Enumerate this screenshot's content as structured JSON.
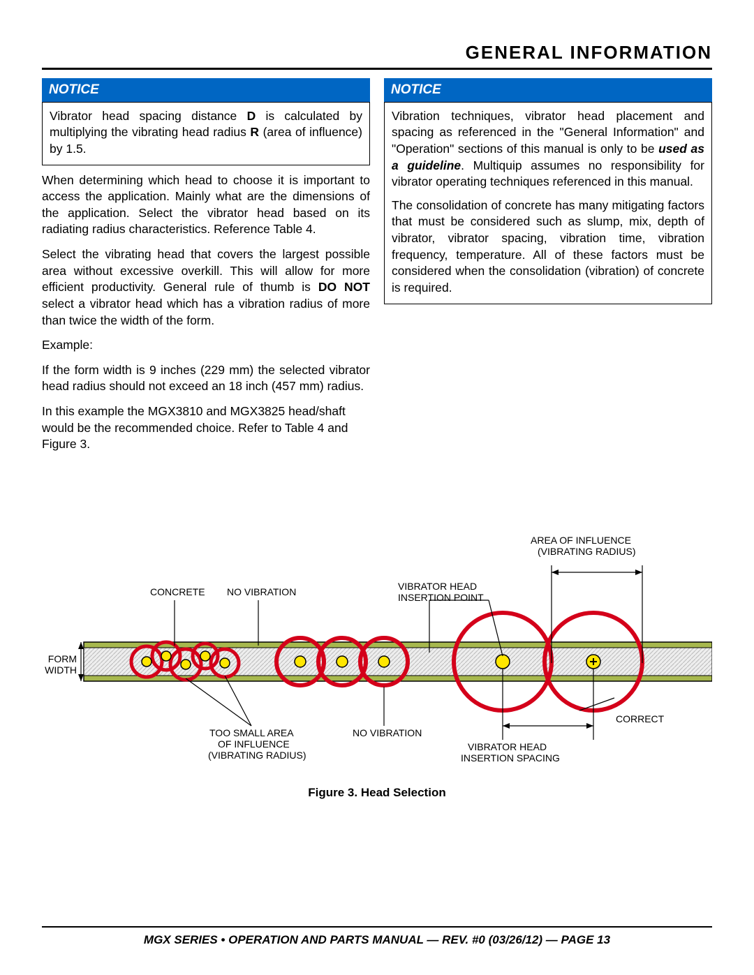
{
  "header": {
    "title": "General Information"
  },
  "left": {
    "notice_label": "NOTICE",
    "notice_body_prefix": "Vibrator head spacing distance ",
    "notice_body_D": "D",
    "notice_body_mid": " is calculated by multiplying the vibrating head radius ",
    "notice_body_R": "R",
    "notice_body_suffix": " (area of influence) by 1.5.",
    "p1": "When determining which head to choose it is important to access the application. Mainly what are the dimensions of the application. Select the vibrator head based on its radiating radius characteristics. Reference Table 4.",
    "p2_prefix": "Select the vibrating head that covers the largest possible area without excessive overkill. This will allow for more efficient productivity. General rule of thumb is ",
    "p2_bold": "DO NOT",
    "p2_suffix": " select a vibrator head which has a vibration radius of more than twice the width of the form.",
    "example_label": "Example:",
    "p3": "If the form width is 9 inches (229 mm) the selected vibrator head radius should not exceed an 18 inch (457 mm) radius.",
    "p4": "In this example the MGX3810 and MGX3825 head/shaft would be the recommended choice. Refer to Table 4 and Figure 3."
  },
  "right": {
    "notice_label": "NOTICE",
    "notice_p1_prefix": "Vibration techniques, vibrator head placement and spacing as referenced in the \"General Information\" and \"Operation\" sections of this manual is only to be ",
    "notice_p1_bold": "used as a guideline",
    "notice_p1_suffix": ". Multiquip assumes no responsibility for vibrator operating techniques referenced in this manual.",
    "notice_p2": "The consolidation of concrete has many mitigating factors that must be considered such as slump, mix, depth of vibrator, vibrator spacing, vibration time, vibration frequency, temperature. All of these factors must be considered when the consolidation (vibration) of concrete is required."
  },
  "figure": {
    "labels": {
      "concrete": "CONCRETE",
      "no_vibration_top": "NO VIBRATION",
      "vib_head_insert_point_l1": "VIBRATOR HEAD",
      "vib_head_insert_point_l2": "INSERTION POINT",
      "area_influence_l1": "AREA OF INFLUENCE",
      "area_influence_l2": "(VIBRATING RADIUS)",
      "form_width_l1": "FORM",
      "form_width_l2": "WIDTH",
      "too_small_l1": "TOO SMALL AREA",
      "too_small_l2": "OF INFLUENCE",
      "too_small_l3": "(VIBRATING RADIUS)",
      "no_vibration_bottom": "NO VIBRATION",
      "vib_head_spacing_l1": "VIBRATOR HEAD",
      "vib_head_spacing_l2": "INSERTION SPACING",
      "correct": "CORRECT"
    },
    "caption": "Figure 3. Head Selection"
  },
  "footer": {
    "text": "MGX SERIES • OPERATION AND PARTS MANUAL — REV. #0 (03/26/12) — PAGE 13"
  }
}
